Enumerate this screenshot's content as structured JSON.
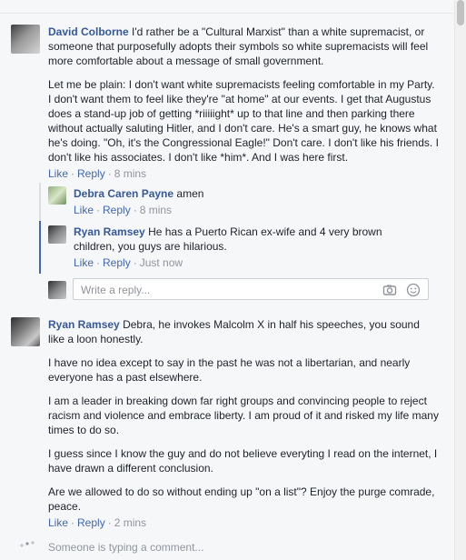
{
  "comments": [
    {
      "author": "David Colborne",
      "paragraphs": [
        "I'd rather be a \"Cultural Marxist\" than a white supremacist, or someone that purposefully adopts their symbols so white supremacists will feel more comfortable about a message of small government.",
        "Let me be plain: I don't want white supremacists feeling comfortable in my Party. I don't want them to feel like they're \"at home\" at our events. I get that Augustus does a stand-up job of getting *riiiiight* up to that line and then parking there without actually saluting Hitler, and I don't care. He's a smart guy, he knows what he's doing. \"Oh, it's the Congressional Eagle!\" Don't care. I don't like his friends. I don't like his associates. I don't like *him*. And I was here first."
      ],
      "like": "Like",
      "reply": "Reply",
      "time": "8 mins",
      "replies": [
        {
          "author": "Debra Caren Payne",
          "text": "amen",
          "like": "Like",
          "reply": "Reply",
          "time": "8 mins"
        },
        {
          "author": "Ryan Ramsey",
          "text": "He has a Puerto Rican ex-wife and 4 very brown children, you guys are hilarious.",
          "like": "Like",
          "reply": "Reply",
          "time": "Just now"
        }
      ]
    },
    {
      "author": "Ryan Ramsey",
      "paragraphs": [
        "Debra, he invokes Malcolm X in half his speeches, you sound like a loon honestly.",
        "I have no idea except to say in the past he was not a libertarian, and nearly everyone has a past elsewhere.",
        "I am a leader in breaking down far right groups and convincing people to reject racism and violence and embrace liberty. I am proud of it and risked my life many times to do so.",
        "I guess since I know the guy and do not believe everyting I read on the internet, I have drawn a different conclusion.",
        "Are we allowed to do so without ending up \"on a list\"? Enjoy the purge comrade, peace."
      ],
      "like": "Like",
      "reply": "Reply",
      "time": "2 mins"
    }
  ],
  "reply_box": {
    "placeholder": "Write a reply..."
  },
  "icons": {
    "camera": "camera-icon",
    "emoji": "emoji-icon",
    "typing": "typing-dots-icon"
  },
  "typing_text": "Someone is typing a comment...",
  "colors": {
    "link": "#365899",
    "action": "#4267b2",
    "muted": "#90949c",
    "background": "#f6f7f9"
  }
}
